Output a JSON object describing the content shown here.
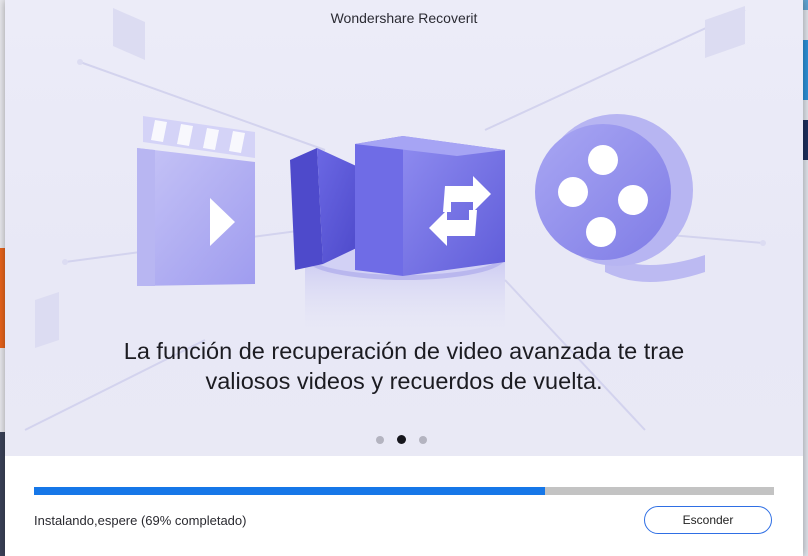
{
  "window": {
    "title": "Wondershare Recoverit"
  },
  "slide": {
    "headline_line1": "La función de recuperación de video avanzada te trae",
    "headline_line2": "valiosos videos y recuerdos de vuelta.",
    "current_slide": 2,
    "total_slides": 3,
    "icons": [
      "clapperboard-icon",
      "video-camera-icon",
      "film-reel-icon"
    ]
  },
  "install": {
    "progress_percent": 69,
    "status_text": "Instalando,espere (69% completado)",
    "hide_button_label": "Esconder"
  },
  "colors": {
    "accent": "#1677e8",
    "track": "#c3c3c3",
    "hero_bg": "#e9e9f5",
    "icon_purple": "#7b79e8"
  }
}
